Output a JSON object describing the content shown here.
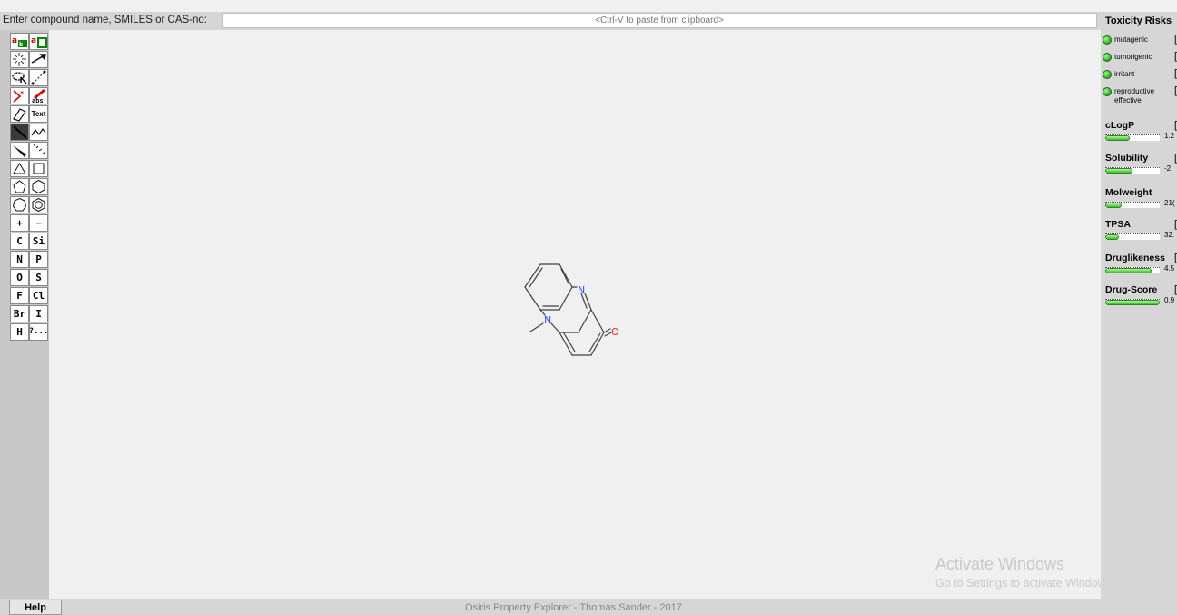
{
  "search": {
    "label": "Enter compound name, SMILES or CAS-no:",
    "placeholder": "<Ctrl-V to paste from clipboard>"
  },
  "toolbar": {
    "tools": [
      [
        "atom-map",
        "unmap"
      ],
      [
        "clean",
        "reaction-arrow"
      ],
      [
        "lasso",
        "select"
      ],
      [
        "stereo",
        "abs"
      ],
      [
        "eraser",
        "Text"
      ],
      [
        "single-bond",
        "chain"
      ],
      [
        "wedge-up",
        "wedge-down"
      ],
      [
        "ring-3",
        "ring-4"
      ],
      [
        "ring-5",
        "ring-6"
      ],
      [
        "ring-7",
        "aromatic-ring"
      ],
      [
        "+",
        "−"
      ],
      [
        "C",
        "Si"
      ],
      [
        "N",
        "P"
      ],
      [
        "O",
        "S"
      ],
      [
        "F",
        "Cl"
      ],
      [
        "Br",
        "I"
      ],
      [
        "H",
        "?..."
      ]
    ]
  },
  "molecule": {
    "atom_labels": [
      "N",
      "N",
      "O"
    ],
    "colors": {
      "nitrogen": "#3050f8",
      "oxygen": "#ff2020",
      "bond": "#404040"
    }
  },
  "panel": {
    "title": "Toxicity Risks",
    "risks": [
      {
        "label": "mutagenic",
        "status": "green"
      },
      {
        "label": "tumorigenic",
        "status": "green"
      },
      {
        "label": "irritant",
        "status": "green"
      },
      {
        "label": "reproductive effective",
        "status": "green"
      }
    ],
    "properties": [
      {
        "label": "cLogP",
        "value": "1.2",
        "level": 0.45
      },
      {
        "label": "Solubility",
        "value": "-2.",
        "level": 0.5
      },
      {
        "label": "Molweight",
        "value": "21(",
        "level": 0.3
      },
      {
        "label": "TPSA",
        "value": "32.",
        "level": 0.25
      },
      {
        "label": "Druglikeness",
        "value": "4.5",
        "level": 0.85
      },
      {
        "label": "Drug-Score",
        "value": "0.9",
        "level": 1.0
      }
    ]
  },
  "watermark": {
    "title": "Activate Windows",
    "subtitle": "Go to Settings to activate Windows."
  },
  "footer": {
    "help_label": "Help",
    "credit": "Osiris Property Explorer - Thomas Sander - 2017"
  }
}
